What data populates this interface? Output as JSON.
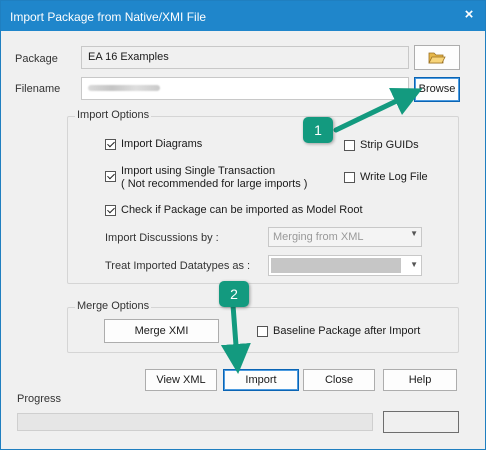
{
  "window": {
    "title": "Import Package from Native/XMI File",
    "close_glyph": "×"
  },
  "package": {
    "label": "Package",
    "value": "EA 16 Examples"
  },
  "filename": {
    "label": "Filename",
    "value": ""
  },
  "buttons": {
    "browse": "Browse",
    "merge_xmi": "Merge XMI",
    "view_xml": "View XML",
    "import": "Import",
    "close": "Close",
    "help": "Help"
  },
  "import_options": {
    "legend": "Import Options",
    "import_diagrams": {
      "label": "Import Diagrams",
      "checked": true
    },
    "single_transaction": {
      "label": "Import using Single Transaction",
      "sublabel": "( Not recommended for large imports )",
      "checked": true
    },
    "model_root": {
      "label": "Check if Package can be imported as Model Root",
      "checked": true
    },
    "strip_guids": {
      "label": "Strip GUIDs",
      "checked": false
    },
    "write_log": {
      "label": "Write Log File",
      "checked": false
    },
    "discussions": {
      "label": "Import Discussions by :",
      "value": "Merging from XML"
    },
    "datatypes": {
      "label": "Treat Imported Datatypes as :",
      "value": ""
    }
  },
  "merge_options": {
    "legend": "Merge Options",
    "baseline": {
      "label": "Baseline Package after Import",
      "checked": false
    }
  },
  "progress": {
    "label": "Progress",
    "value": 0
  },
  "callouts": [
    {
      "number": "1"
    },
    {
      "number": "2"
    }
  ],
  "colors": {
    "title_bar": "#1f86cb",
    "callout": "#139a7f"
  },
  "icons": {
    "folder": "folder-open-icon",
    "close": "close-icon"
  }
}
